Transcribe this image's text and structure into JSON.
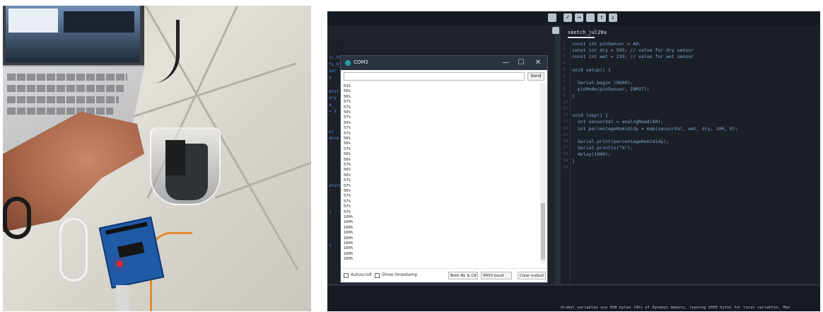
{
  "ide": {
    "tab_name": "sketch_jul20a",
    "code_lines": [
      "const int pinSensor = A0;",
      "const int dry = 595; // value for dry sensor",
      "const int wet = 239; // value for wet sensor",
      "",
      "void setup() {",
      "",
      "  Serial.begin (9600);",
      "  pinMode(pinSensor, INPUT);",
      "}",
      "",
      "",
      "void loop() {",
      "  int sensorVal = analogRead(A0);",
      "  int percentageHumididy = map(sensorVal, wet, dry, 100, 0);",
      "",
      "  Serial.print(percentageHumididy);",
      "  Serial.println(\"%\");",
      "  delay(1000);",
      "}"
    ],
    "gutter_numbers": [
      "1",
      "2",
      "3",
      "4",
      "5",
      "6",
      "7",
      "8",
      "9",
      "10",
      "11",
      "12",
      "13",
      "14",
      "15",
      "16",
      "17",
      "18",
      "19",
      "20"
    ],
    "console_message": "Global variables use 998 bytes (9%) of dynamic memory, leaving 1050 bytes for local variables. Max"
  },
  "serial_monitor": {
    "title": "COM3",
    "minimize": "—",
    "maximize": "☐",
    "close": "✕",
    "send_label": "Send",
    "input_value": "",
    "output_lines": [
      "61%",
      "56%",
      "56%",
      "57%",
      "57%",
      "56%",
      "57%",
      "56%",
      "57%",
      "57%",
      "56%",
      "56%",
      "57%",
      "56%",
      "56%",
      "57%",
      "56%",
      "56%",
      "57%",
      "57%",
      "56%",
      "57%",
      "57%",
      "57%",
      "57%",
      "100%",
      "100%",
      "100%",
      "100%",
      "100%",
      "100%",
      "100%",
      "100%",
      "100%"
    ],
    "autoscroll_label": "Autoscroll",
    "timestamp_label": "Show timestamp",
    "line_ending": "Both NL & CR",
    "baud": "9600 baud",
    "clear_label": "Clear output"
  },
  "sidebar_fragments": [
    "ic.h>",
    "fv.h\"",
    "sor",
    "0",
    "",
    "ator",
    "ary",
    "a_",
    "= 2",
    "",
    " ",
    "or",
    "ance",
    "",
    "",
    "",
    "",
    "",
    "",
    "ature",
    "",
    "",
    "",
    "(",
    "",
    "",
    "",
    "",
    "(",
    "",
    "",
    ""
  ]
}
